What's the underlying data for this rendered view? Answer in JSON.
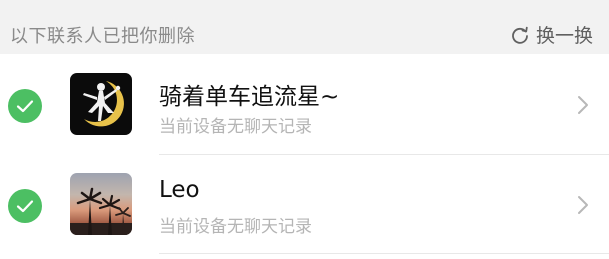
{
  "header": {
    "title": "以下联系人已把你删除",
    "refresh_label": "换一换",
    "refresh_icon": "refresh-icon"
  },
  "contacts": [
    {
      "name": "骑着单车追流星~",
      "status": "当前设备无聊天记录",
      "checked": true,
      "avatar_icon": "sailor-moon-silhouette-avatar",
      "chevron_icon": "chevron-right-icon"
    },
    {
      "name": "Leo",
      "status": "当前设备无聊天记录",
      "checked": true,
      "avatar_icon": "palm-trees-sunset-avatar",
      "chevron_icon": "chevron-right-icon"
    }
  ],
  "colors": {
    "check_green": "#4cbf63",
    "header_bg": "#f2f2f2",
    "subtext": "#b5b5b5"
  }
}
